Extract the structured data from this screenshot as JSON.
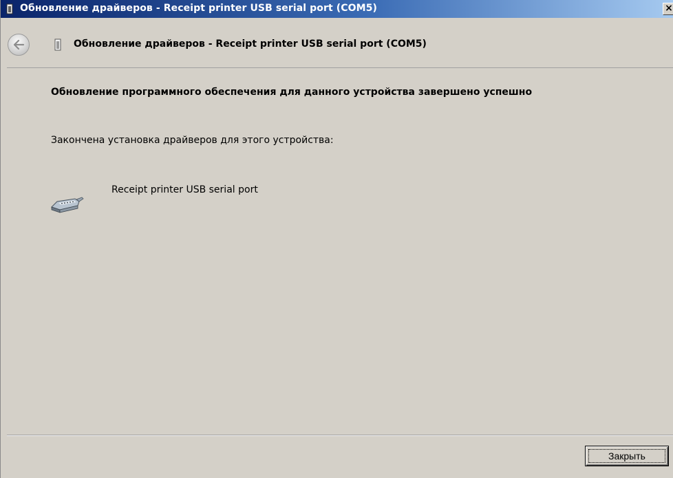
{
  "window": {
    "title": "Обновление драйверов - Receipt printer USB serial port (COM5)",
    "close_glyph": "×"
  },
  "nav": {
    "back_icon": "back-arrow-icon",
    "title": "Обновление драйверов - Receipt printer USB serial port (COM5)"
  },
  "content": {
    "heading": "Обновление программного обеспечения для данного устройства завершено успешно",
    "description": "Закончена установка драйверов для этого устройства:",
    "device_icon": "serial-port-icon",
    "device_name": "Receipt printer USB serial port"
  },
  "footer": {
    "close_label": "Закрыть"
  },
  "colors": {
    "dialog_background": "#d4d0c8",
    "titlebar_start": "#0a246a",
    "titlebar_end": "#a6caf0"
  }
}
